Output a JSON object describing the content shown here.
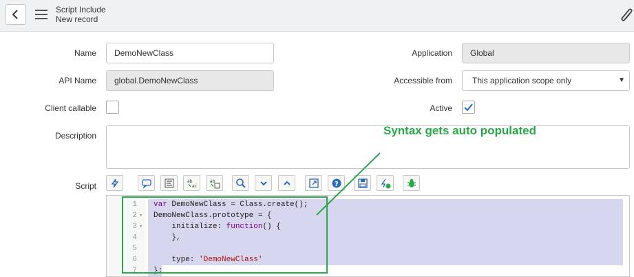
{
  "header": {
    "title": "Script Include",
    "subtitle": "New record"
  },
  "form": {
    "name_label": "Name",
    "name_value": "DemoNewClass",
    "api_name_label": "API Name",
    "api_name_value": "global.DemoNewClass",
    "client_callable_label": "Client callable",
    "client_callable_checked": false,
    "description_label": "Description",
    "script_label": "Script",
    "application_label": "Application",
    "application_value": "Global",
    "accessible_from_label": "Accessible from",
    "accessible_from_value": "This application scope only",
    "active_label": "Active",
    "active_checked": true
  },
  "editor": {
    "lines": [
      {
        "number": "1",
        "fold": "",
        "text": "var DemoNewClass = Class.create();"
      },
      {
        "number": "2",
        "fold": "▾",
        "text": "DemoNewClass.prototype = {"
      },
      {
        "number": "3",
        "fold": "▾",
        "text": "    initialize: function() {"
      },
      {
        "number": "4",
        "fold": "",
        "text": "    },"
      },
      {
        "number": "5",
        "fold": "",
        "text": ""
      },
      {
        "number": "6",
        "fold": "",
        "text": "    type: 'DemoNewClass'"
      },
      {
        "number": "7",
        "fold": "",
        "text": "};"
      }
    ]
  },
  "annotation": {
    "text": "Syntax gets auto populated",
    "color": "#2aa84a"
  },
  "icons": {
    "back": "chevron-left-icon",
    "menu": "hamburger-menu-icon",
    "attach": "paperclip-icon"
  }
}
